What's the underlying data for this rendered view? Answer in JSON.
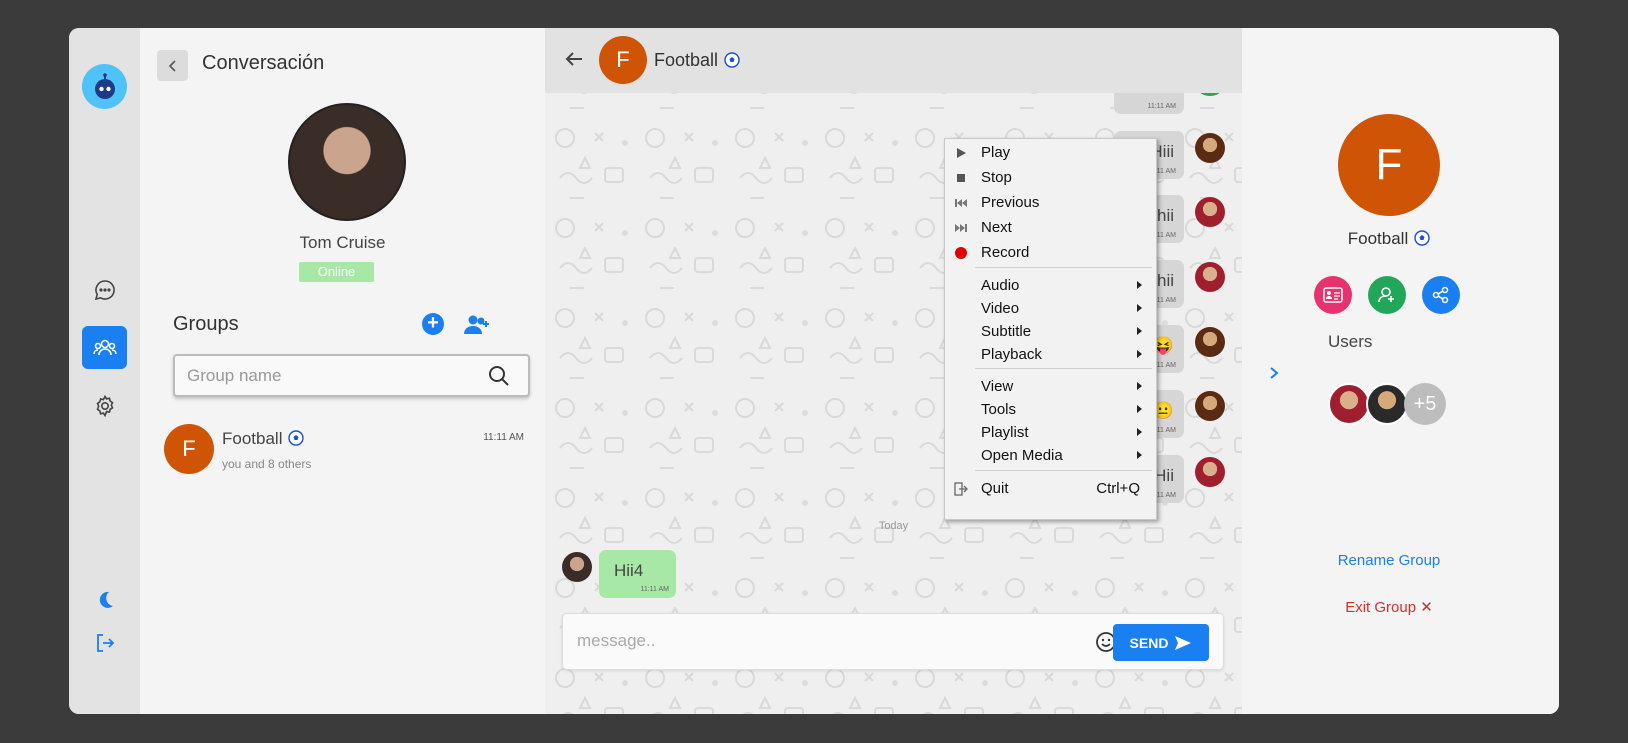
{
  "sidebar": {
    "icons": [
      "robot-logo-icon",
      "chat-icon",
      "groups-icon",
      "settings-icon",
      "moon-icon",
      "logout-icon"
    ]
  },
  "left": {
    "title": "Conversación",
    "profile": {
      "name": "Tom Cruise",
      "status": "Online"
    },
    "groups_label": "Groups",
    "search_placeholder": "Group name",
    "groups": [
      {
        "initial": "F",
        "name": "Football",
        "subtitle": "you and 8 others",
        "time": "11:11 AM"
      }
    ]
  },
  "chat": {
    "initial": "F",
    "name": "Football",
    "messages_right": [
      {
        "text": "",
        "time": "11:11 AM"
      },
      {
        "text": "Hiii",
        "time": "11:11 AM"
      },
      {
        "text": "hii",
        "time": "11:11 AM"
      },
      {
        "text": "hii",
        "time": "11:11 AM"
      },
      {
        "text": "😁😝",
        "time": "11:11 AM"
      },
      {
        "text": "😐😐",
        "time": "11:11 AM"
      },
      {
        "text": "Hii",
        "time": "11:11 AM"
      }
    ],
    "divider": "Today",
    "my_message": {
      "text": "Hii4",
      "time": "11:11 AM"
    },
    "composer_placeholder": "message..",
    "send_label": "SEND"
  },
  "context_menu": {
    "items": [
      {
        "label": "Play"
      },
      {
        "label": "Stop"
      },
      {
        "label": "Previous"
      },
      {
        "label": "Next"
      },
      {
        "label": "Record"
      },
      {
        "label": "Audio"
      },
      {
        "label": "Video"
      },
      {
        "label": "Subtitle"
      },
      {
        "label": "Playback"
      },
      {
        "label": "View"
      },
      {
        "label": "Tools"
      },
      {
        "label": "Playlist"
      },
      {
        "label": "Open Media"
      },
      {
        "label": "Quit",
        "shortcut": "Ctrl+Q"
      }
    ]
  },
  "right": {
    "initial": "F",
    "name": "Football",
    "users_label": "Users",
    "more_users": "+5",
    "rename_label": "Rename Group",
    "exit_label": "Exit Group ✕"
  },
  "colors": {
    "accent": "#1a7ff0",
    "group_avatar": "#d05405",
    "online_badge": "#a7e8a7",
    "danger": "#d32f2f"
  }
}
